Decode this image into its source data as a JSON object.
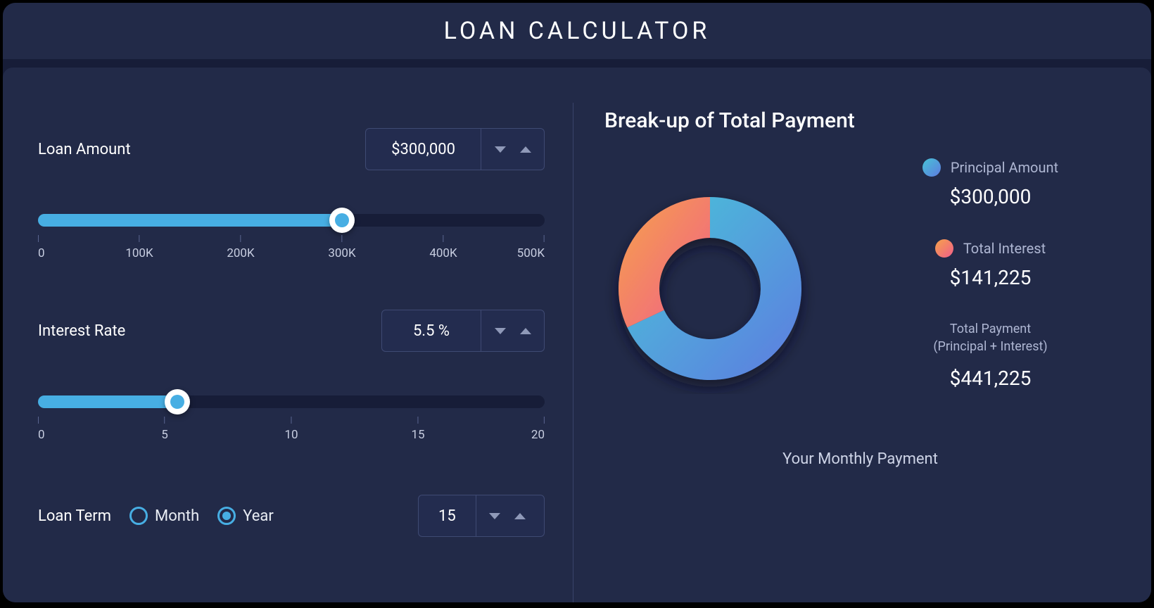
{
  "title": "LOAN CALCULATOR",
  "loan_amount": {
    "label": "Loan Amount",
    "value_display": "$300,000",
    "value": 300000,
    "min": 0,
    "max": 500000,
    "ticks": [
      "0",
      "100K",
      "200K",
      "300K",
      "400K",
      "500K"
    ],
    "percent": 60
  },
  "interest_rate": {
    "label": "Interest Rate",
    "value_display": "5.5 %",
    "value": 5.5,
    "min": 0,
    "max": 20,
    "ticks": [
      "0",
      "5",
      "10",
      "15",
      "20"
    ],
    "percent": 27.5
  },
  "loan_term": {
    "label": "Loan Term",
    "value_display": "15",
    "value": 15,
    "unit_options": [
      "Month",
      "Year"
    ],
    "unit_selected": "Year"
  },
  "breakup": {
    "title": "Break-up of Total Payment",
    "principal": {
      "label": "Principal Amount",
      "value_display": "$300,000",
      "value": 300000,
      "swatch": "linear-gradient(135deg,#47c3d6,#5e7be0)"
    },
    "interest": {
      "label": "Total Interest",
      "value_display": "$141,225",
      "value": 141225,
      "swatch": "linear-gradient(135deg,#f5a24a,#f15e8a)"
    },
    "total": {
      "label": "Total Payment",
      "sublabel": "(Principal + Interest)",
      "value_display": "$441,225",
      "value": 441225
    }
  },
  "monthly_label": "Your Monthly Payment",
  "chart_data": {
    "type": "pie",
    "title": "Break-up of Total Payment",
    "series": [
      {
        "name": "Principal Amount",
        "value": 300000
      },
      {
        "name": "Total Interest",
        "value": 141225
      }
    ],
    "total": 441225
  }
}
